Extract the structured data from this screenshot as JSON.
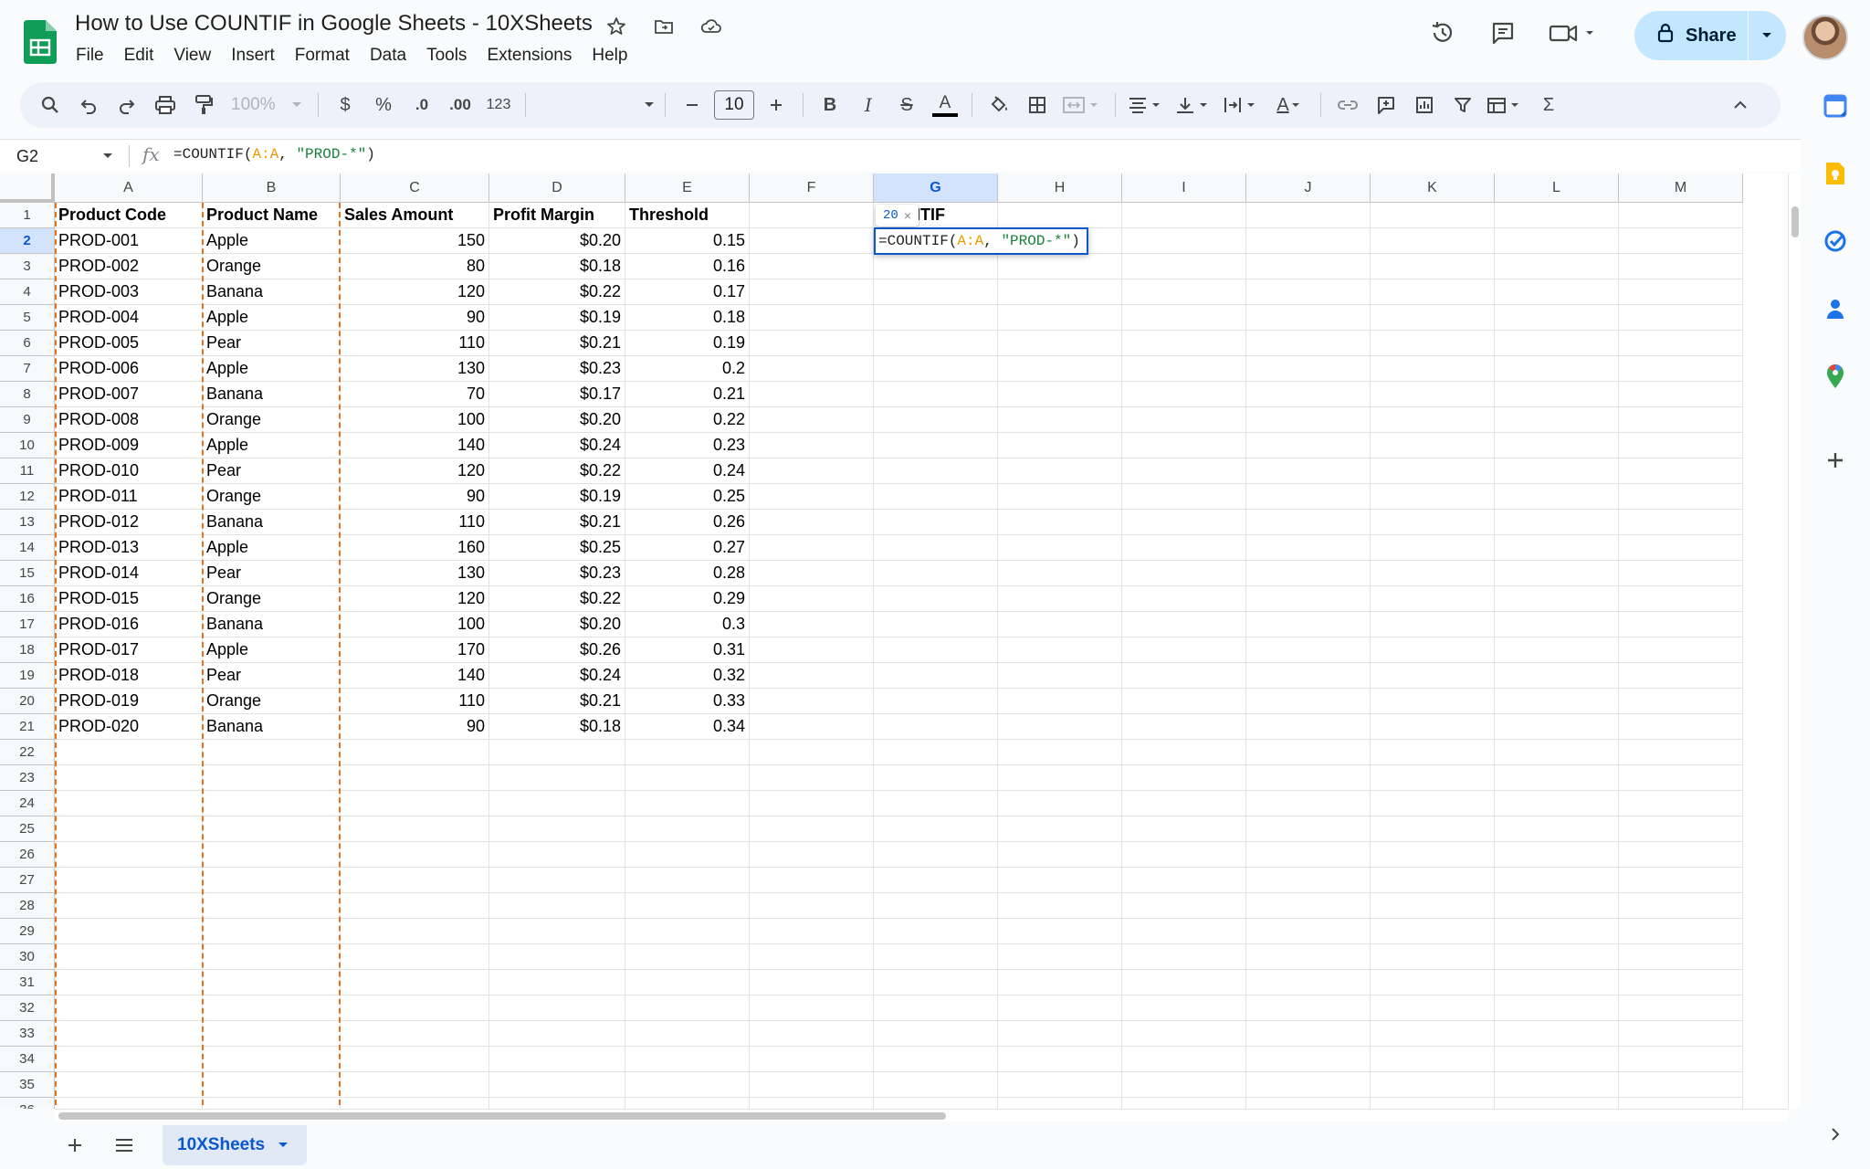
{
  "app": {
    "title": "How to Use COUNTIF in Google Sheets - 10XSheets",
    "menu": [
      "File",
      "Edit",
      "View",
      "Insert",
      "Format",
      "Data",
      "Tools",
      "Extensions",
      "Help"
    ],
    "share_label": "Share"
  },
  "toolbar": {
    "zoom": "100%",
    "currency": "$",
    "percent": "%",
    "decrease_decimal": ".0",
    "increase_decimal": ".00",
    "number_format": "123",
    "font_size": "10",
    "bold": "B",
    "italic": "I",
    "strike": "S",
    "text_color": "A",
    "text_rotation": "A",
    "sum": "Σ"
  },
  "formula_bar": {
    "cell_ref": "G2",
    "fx": "fx",
    "formula_parts": [
      {
        "t": "=COUNTIF(",
        "c": "plain"
      },
      {
        "t": "A:A",
        "c": "ref"
      },
      {
        "t": ", ",
        "c": "plain"
      },
      {
        "t": "\"PROD-*\"",
        "c": "str"
      },
      {
        "t": ")",
        "c": "plain"
      }
    ]
  },
  "grid": {
    "columns": [
      "A",
      "B",
      "C",
      "D",
      "E",
      "F",
      "G",
      "H",
      "I",
      "J",
      "K",
      "L",
      "M"
    ],
    "selected_column": "G",
    "selected_row": 2,
    "row_count_visible": 35,
    "headers": [
      "Product Code",
      "Product Name",
      "Sales Amount",
      "Profit Margin",
      "Threshold"
    ],
    "g1_header": "NTIF",
    "rows": [
      [
        "PROD-001",
        "Apple",
        "150",
        "$0.20",
        "0.15"
      ],
      [
        "PROD-002",
        "Orange",
        "80",
        "$0.18",
        "0.16"
      ],
      [
        "PROD-003",
        "Banana",
        "120",
        "$0.22",
        "0.17"
      ],
      [
        "PROD-004",
        "Apple",
        "90",
        "$0.19",
        "0.18"
      ],
      [
        "PROD-005",
        "Pear",
        "110",
        "$0.21",
        "0.19"
      ],
      [
        "PROD-006",
        "Apple",
        "130",
        "$0.23",
        "0.2"
      ],
      [
        "PROD-007",
        "Banana",
        "70",
        "$0.17",
        "0.21"
      ],
      [
        "PROD-008",
        "Orange",
        "100",
        "$0.20",
        "0.22"
      ],
      [
        "PROD-009",
        "Apple",
        "140",
        "$0.24",
        "0.23"
      ],
      [
        "PROD-010",
        "Pear",
        "120",
        "$0.22",
        "0.24"
      ],
      [
        "PROD-011",
        "Orange",
        "90",
        "$0.19",
        "0.25"
      ],
      [
        "PROD-012",
        "Banana",
        "110",
        "$0.21",
        "0.26"
      ],
      [
        "PROD-013",
        "Apple",
        "160",
        "$0.25",
        "0.27"
      ],
      [
        "PROD-014",
        "Pear",
        "130",
        "$0.23",
        "0.28"
      ],
      [
        "PROD-015",
        "Orange",
        "120",
        "$0.22",
        "0.29"
      ],
      [
        "PROD-016",
        "Banana",
        "100",
        "$0.20",
        "0.3"
      ],
      [
        "PROD-017",
        "Apple",
        "170",
        "$0.26",
        "0.31"
      ],
      [
        "PROD-018",
        "Pear",
        "140",
        "$0.24",
        "0.32"
      ],
      [
        "PROD-019",
        "Orange",
        "110",
        "$0.21",
        "0.33"
      ],
      [
        "PROD-020",
        "Banana",
        "90",
        "$0.18",
        "0.34"
      ]
    ],
    "preview_value": "20",
    "preview_close": "×"
  },
  "sheet_tab": {
    "name": "10XSheets"
  },
  "colors": {
    "accent": "#0b57d0",
    "share_bg": "#c2e7ff",
    "copy_border": "#e8711a",
    "formula_ref": "#f29900",
    "formula_string": "#188038"
  },
  "side_panel_icons": [
    "calendar-icon",
    "keep-icon",
    "tasks-icon",
    "contacts-icon",
    "maps-icon",
    "add-icon"
  ]
}
